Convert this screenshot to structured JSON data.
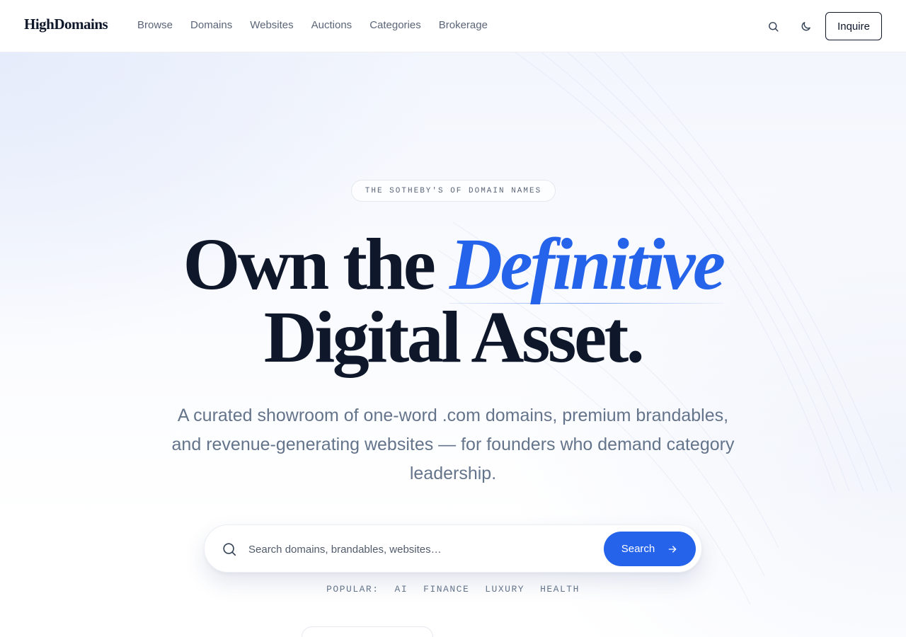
{
  "brand": {
    "logo": "HighDomains"
  },
  "nav": {
    "items": [
      "Browse",
      "Domains",
      "Websites",
      "Auctions",
      "Categories",
      "Brokerage"
    ],
    "search_icon": "search-icon",
    "theme_icon": "moon-icon",
    "inquire_label": "Inquire"
  },
  "hero": {
    "eyebrow": "THE SOTHEBY'S OF DOMAIN NAMES",
    "headline_part1": "Own the ",
    "headline_accent": "Definitive",
    "headline_line2": "Digital Asset.",
    "subcopy": "A curated showroom of one-word .com domains, premium brandables, and revenue-generating websites — for founders who demand category leadership."
  },
  "search": {
    "placeholder": "Search domains, brandables, websites…",
    "button_label": "Search"
  },
  "popular": {
    "label": "POPULAR:",
    "tags": [
      "AI",
      "FINANCE",
      "LUXURY",
      "HEALTH"
    ]
  },
  "colors": {
    "accent": "#2563eb",
    "text": "#0f172a",
    "muted": "#64748b"
  }
}
